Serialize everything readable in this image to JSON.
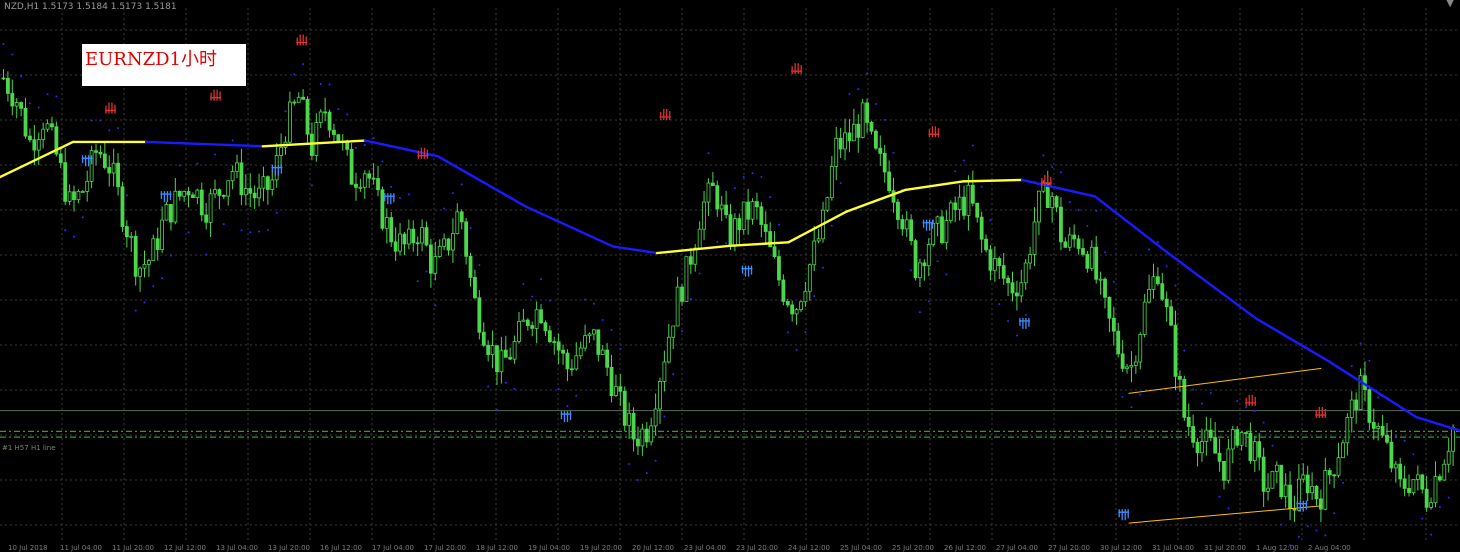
{
  "header": {
    "symbol_line": "NZD,H1  1.5173 1.5184 1.5173 1.5181"
  },
  "title": "EURNZD1小时",
  "hline_label": "#1 H57 H1 line",
  "colors": {
    "background": "#000000",
    "grid": "#3a3a3a",
    "candle": "#4cd64c",
    "ma_up": "#ffff33",
    "ma_down": "#1a1aff",
    "sar": "#2a2aff",
    "fractal_up": "#e03030",
    "fractal_down": "#3f8cff",
    "channel": "#ffc000",
    "dashline": "#2e9c2e",
    "hline": "#5a6a5a"
  },
  "chart_data": {
    "type": "candlestick",
    "symbol": "EURNZD",
    "timeframe": "H1",
    "x_tick_labels": [
      "10 Jul 2018",
      "11 Jul 04:00",
      "11 Jul 20:00",
      "12 Jul 12:00",
      "13 Jul 04:00",
      "13 Jul 20:00",
      "16 Jul 12:00",
      "17 Jul 04:00",
      "17 Jul 20:00",
      "18 Jul 12:00",
      "19 Jul 04:00",
      "19 Jul 20:00",
      "20 Jul 12:00",
      "23 Jul 04:00",
      "23 Jul 20:00",
      "24 Jul 12:00",
      "25 Jul 04:00",
      "25 Jul 20:00",
      "26 Jul 12:00",
      "27 Jul 04:00",
      "27 Jul 20:00",
      "30 Jul 12:00",
      "31 Jul 04:00",
      "31 Jul 20:00",
      "1 Aug 12:00",
      "2 Aug 04:00"
    ],
    "price_path": [
      70,
      92,
      135,
      110,
      150,
      200,
      180,
      140,
      160,
      210,
      260,
      250,
      210,
      190,
      175,
      200,
      185,
      160,
      180,
      190,
      175,
      120,
      90,
      140,
      100,
      130,
      170,
      160,
      200,
      230,
      240,
      220,
      260,
      240,
      200,
      290,
      330,
      360,
      340,
      310,
      300,
      330,
      360,
      340,
      330,
      360,
      400,
      430,
      420,
      360,
      300,
      260,
      200,
      180,
      230,
      210,
      200,
      240,
      280,
      300,
      260,
      220,
      140,
      130,
      110,
      150,
      170,
      210,
      260,
      230,
      220,
      200,
      190,
      240,
      260,
      280,
      270,
      200,
      180,
      240,
      230,
      250,
      300,
      340,
      360,
      300,
      260,
      330,
      410,
      430,
      440,
      460,
      420,
      440,
      480,
      470,
      500,
      470,
      490,
      460,
      420,
      380,
      410,
      440,
      480,
      470,
      490,
      460,
      420
    ],
    "moving_average": [
      {
        "p": 0,
        "v": 1.5368
      },
      {
        "p": 0.05,
        "v": 1.5417
      },
      {
        "p": 0.1,
        "v": 1.5417
      },
      {
        "p": 0.18,
        "v": 1.5411
      },
      {
        "p": 0.25,
        "v": 1.5419
      },
      {
        "p": 0.3,
        "v": 1.5397
      },
      {
        "p": 0.36,
        "v": 1.5327
      },
      {
        "p": 0.42,
        "v": 1.5271
      },
      {
        "p": 0.45,
        "v": 1.5262
      },
      {
        "p": 0.5,
        "v": 1.5272
      },
      {
        "p": 0.54,
        "v": 1.5277
      },
      {
        "p": 0.58,
        "v": 1.532
      },
      {
        "p": 0.62,
        "v": 1.535
      },
      {
        "p": 0.66,
        "v": 1.5362
      },
      {
        "p": 0.7,
        "v": 1.5364
      },
      {
        "p": 0.75,
        "v": 1.5341
      },
      {
        "p": 0.8,
        "v": 1.5262
      },
      {
        "p": 0.86,
        "v": 1.5171
      },
      {
        "p": 0.91,
        "v": 1.5111
      },
      {
        "p": 0.97,
        "v": 1.5033
      },
      {
        "p": 1,
        "v": 1.5014
      }
    ],
    "fractals_up": [
      {
        "p": 0.076,
        "v": 1.5465
      },
      {
        "p": 0.148,
        "v": 1.5483
      },
      {
        "p": 0.207,
        "v": 1.556
      },
      {
        "p": 0.29,
        "v": 1.5402
      },
      {
        "p": 0.456,
        "v": 1.5456
      },
      {
        "p": 0.546,
        "v": 1.552
      },
      {
        "p": 0.64,
        "v": 1.5432
      },
      {
        "p": 0.717,
        "v": 1.5364
      },
      {
        "p": 0.857,
        "v": 1.5057
      },
      {
        "p": 0.905,
        "v": 1.504
      }
    ],
    "fractals_down": [
      {
        "p": 0.06,
        "v": 1.539
      },
      {
        "p": 0.114,
        "v": 1.534
      },
      {
        "p": 0.19,
        "v": 1.5377
      },
      {
        "p": 0.267,
        "v": 1.5337
      },
      {
        "p": 0.388,
        "v": 1.5033
      },
      {
        "p": 0.512,
        "v": 1.5236
      },
      {
        "p": 0.636,
        "v": 1.53
      },
      {
        "p": 0.702,
        "v": 1.5163
      },
      {
        "p": 0.77,
        "v": 1.4896
      },
      {
        "p": 0.892,
        "v": 1.4908
      }
    ],
    "channel_upper": [
      {
        "p": 0.773,
        "v": 1.5066
      },
      {
        "p": 0.905,
        "v": 1.5101
      }
    ],
    "channel_lower": [
      {
        "p": 0.773,
        "v": 1.4885
      },
      {
        "p": 0.905,
        "v": 1.4909
      }
    ],
    "dash_levels": [
      1.5013,
      1.5005
    ],
    "solid_level": 1.5042,
    "y_range": [
      1.486,
      1.5604
    ],
    "grid": true
  }
}
